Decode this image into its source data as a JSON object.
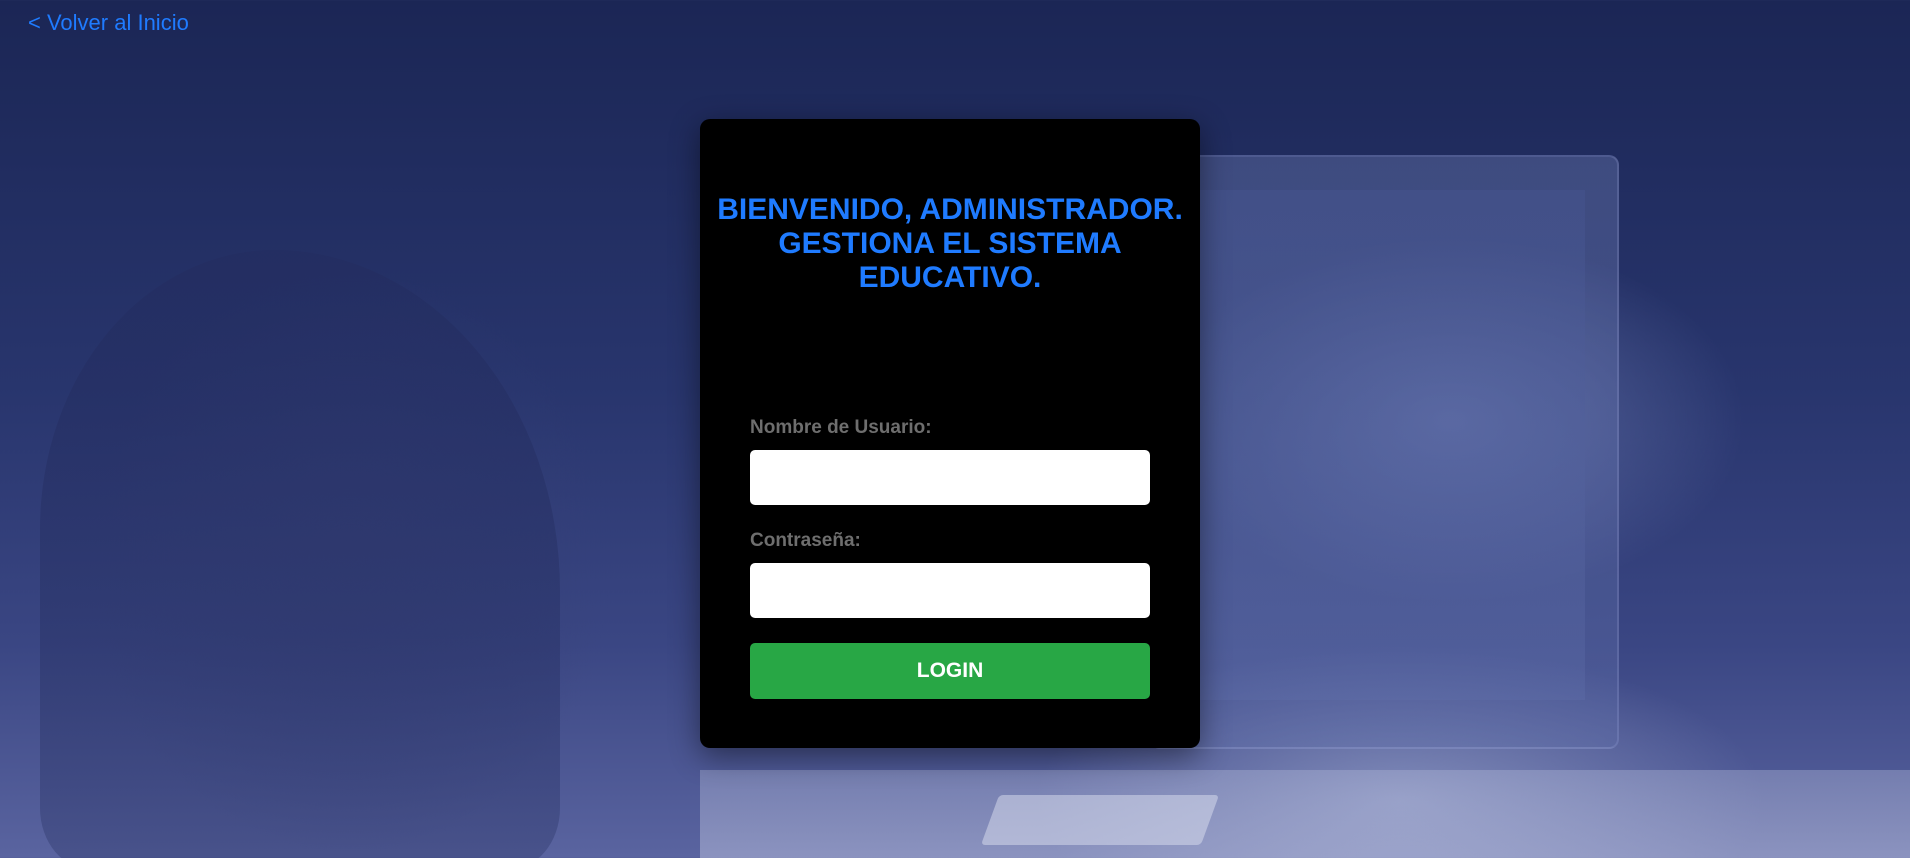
{
  "nav": {
    "back_link": "< Volver al Inicio"
  },
  "login": {
    "title": "BIENVENIDO, ADMINISTRADOR. GESTIONA EL SISTEMA EDUCATIVO.",
    "username_label": "Nombre de Usuario:",
    "username_value": "",
    "password_label": "Contraseña:",
    "password_value": "",
    "submit_label": "LOGIN"
  },
  "colors": {
    "accent": "#1f7bff",
    "button": "#28a745",
    "card": "#000000",
    "background": "#28356d",
    "label": "#6e6e6e"
  }
}
